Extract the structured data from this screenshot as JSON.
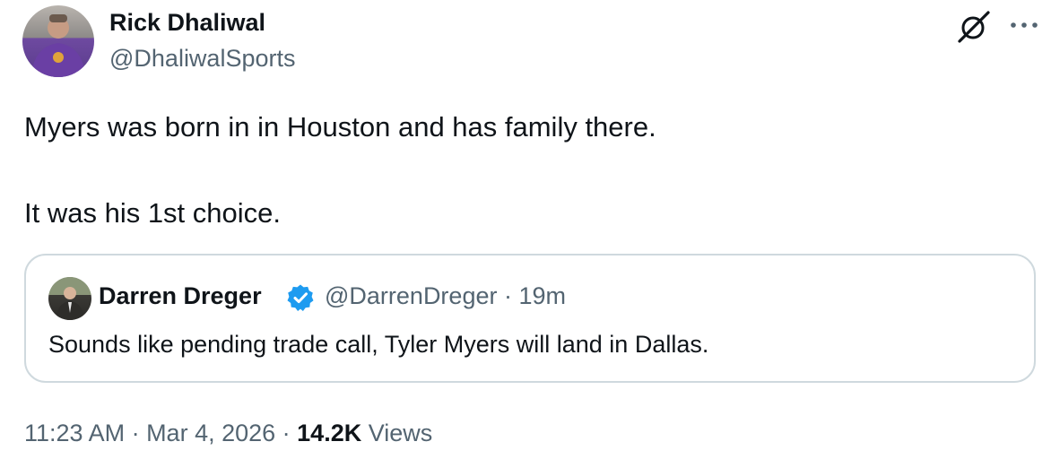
{
  "author": {
    "name": "Rick Dhaliwal",
    "handle": "@DhaliwalSports"
  },
  "tweet": {
    "line1": "Myers was born in in Houston and has family there.",
    "line2": "It was his 1st choice."
  },
  "quote": {
    "name": "Darren Dreger",
    "handle_time": "@DarrenDreger · 19m",
    "text": "Sounds like pending trade call, Tyler Myers will land in Dallas."
  },
  "meta": {
    "time_date": "11:23 AM · Mar 4, 2026 · ",
    "views_count": "14.2K",
    "views_label": " Views"
  },
  "icons": {
    "grok": "grok-icon",
    "more": "more-icon",
    "verified": "verified-badge-icon"
  },
  "colors": {
    "text": "#0f1419",
    "secondary": "#536471",
    "verified": "#1d9bf0",
    "border": "#cfd9de"
  }
}
